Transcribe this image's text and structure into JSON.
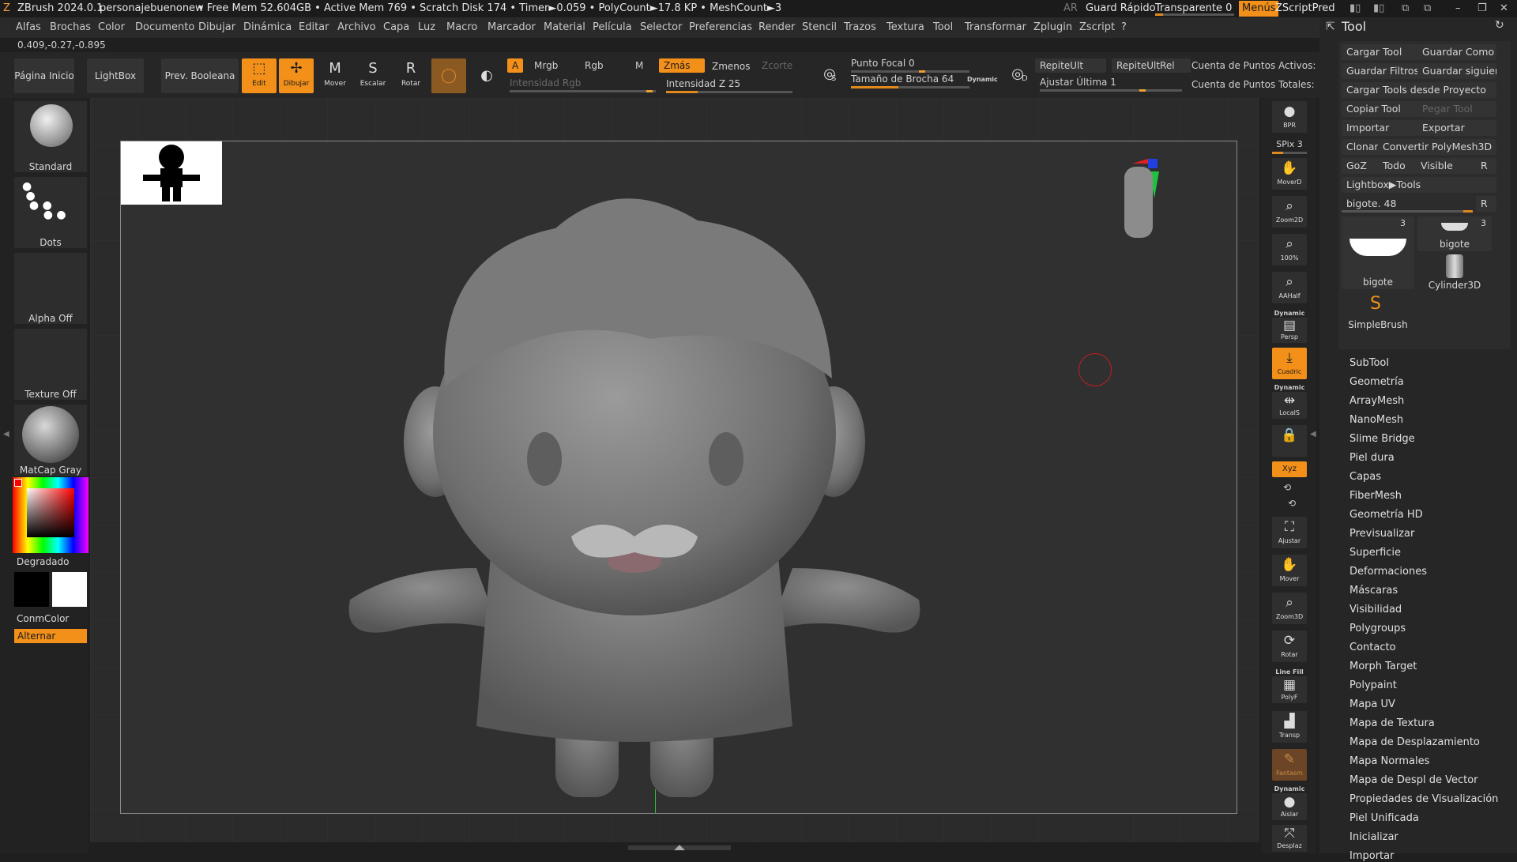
{
  "titlebar": {
    "app": "ZBrush 2024.0.1",
    "project": "personajebuenonew",
    "stats": "• Free Mem 52.604GB • Active Mem 769 • Scratch Disk 174 • Timer►0.059 • PolyCount►17.8 KP • MeshCount►3",
    "ar": "AR",
    "quicksave": "Guard Rápido",
    "transparent": "Transparente 0",
    "menus": "Menús",
    "zscript": "ZScriptPred"
  },
  "menubar": [
    "Alfas",
    "Brochas",
    "Color",
    "Documento",
    "Dibujar",
    "Dinámica",
    "Editar",
    "Archivo",
    "Capa",
    "Luz",
    "Macro",
    "Marcador",
    "Material",
    "Película",
    "Selector",
    "Preferencias",
    "Render",
    "Stencil",
    "Trazos",
    "Textura",
    "Tool",
    "Transformar",
    "Zplugin",
    "Zscript",
    "?"
  ],
  "coords": "0.409,-0.27,-0.895",
  "shelf": {
    "home": "Página Inicio",
    "lightbox": "LightBox",
    "boolean": "Prev. Booleana",
    "edit": "Edit",
    "draw": "Dibujar",
    "move": "Mover",
    "scale": "Escalar",
    "rotate": "Rotar",
    "a": "A",
    "mrgb": "Mrgb",
    "rgb": "Rgb",
    "m": "M",
    "rgb_intensity": "Intensidad Rgb",
    "zadd": "Zmás",
    "zsub": "Zmenos",
    "zcut": "Zcorte",
    "z_intensity": "Intensidad Z 25",
    "z_intensity_value": 25,
    "s_label": "S",
    "focal": "Punto Focal 0",
    "brush_size": "Tamaño de Brocha 64",
    "brush_size_value": 64,
    "dynamic": "Dynamic",
    "d_label": "D",
    "repeat_last": "RepiteUlt",
    "repeat_last_rel": "RepiteUltRel",
    "adjust_last": "Ajustar Última 1",
    "active_points": "Cuenta de Puntos Activos:",
    "total_points": "Cuenta de Puntos Totales:"
  },
  "left_panel": {
    "brush": "Standard",
    "stroke": "Dots",
    "alpha": "Alpha Off",
    "texture": "Texture Off",
    "material": "MatCap Gray",
    "gradient": "Degradado",
    "conmcolor": "ConmColor",
    "switch": "Alternar"
  },
  "right_bar": [
    {
      "label": "BPR"
    },
    {
      "label": "SPix 3"
    },
    {
      "label": "MoverD"
    },
    {
      "label": "Zoom2D"
    },
    {
      "label": "100%"
    },
    {
      "label": "AAHalf"
    },
    {
      "label": "Persp"
    },
    {
      "label": "Cuadric"
    },
    {
      "label": "LocalS"
    },
    {
      "label": "Xyz"
    },
    {
      "label": "Ajustar"
    },
    {
      "label": "Mover"
    },
    {
      "label": "Zoom3D"
    },
    {
      "label": "Rotar"
    },
    {
      "label": "PolyF"
    },
    {
      "label": "Transp"
    },
    {
      "label": "Fantasm"
    },
    {
      "label": "Aislar"
    },
    {
      "label": "Desplaz"
    }
  ],
  "right_tags": {
    "dynamic1": "Dynamic",
    "dynamic2": "Dynamic",
    "linefill": "Line Fill",
    "dynamic3": "Dynamic"
  },
  "tool_panel": {
    "title": "Tool",
    "buttons": [
      [
        "Cargar Tool",
        "Guardar Como"
      ],
      [
        "Guardar Filtros",
        "Guardar siguien"
      ]
    ],
    "load_project": "Cargar Tools desde Proyecto",
    "copy": "Copiar Tool",
    "paste": "Pegar Tool",
    "import": "Importar",
    "export": "Exportar",
    "clone": "Clonar",
    "convert": "Convertir PolyMesh3D",
    "goz": "GoZ",
    "all": "Todo",
    "visible": "Visible",
    "r": "R",
    "lightbox_tools": "Lightbox▶Tools",
    "current": "bigote. 48",
    "thumbs": [
      {
        "name": "bigote",
        "count": "3"
      },
      {
        "name": "bigote",
        "count": "3"
      },
      {
        "name": "Cylinder3D",
        "count": ""
      },
      {
        "name": "SimpleBrush",
        "count": ""
      }
    ],
    "sections": [
      "SubTool",
      "Geometría",
      "ArrayMesh",
      "NanoMesh",
      "Slime Bridge",
      "Piel dura",
      "Capas",
      "FiberMesh",
      "Geometría HD",
      "Previsualizar",
      "Superficie",
      "Deformaciones",
      "Máscaras",
      "Visibilidad",
      "Polygroups",
      "Contacto",
      "Morph Target",
      "Polypaint",
      "Mapa UV",
      "Mapa de Textura",
      "Mapa de Desplazamiento",
      "Mapa Normales",
      "Mapa de Despl de Vector",
      "Propiedades de Visualización",
      "Piel Unificada",
      "Inicializar",
      "Importar"
    ]
  },
  "colors": {
    "accent": "#f2901a",
    "bg": "#1f1f1f",
    "panel": "#262626"
  }
}
